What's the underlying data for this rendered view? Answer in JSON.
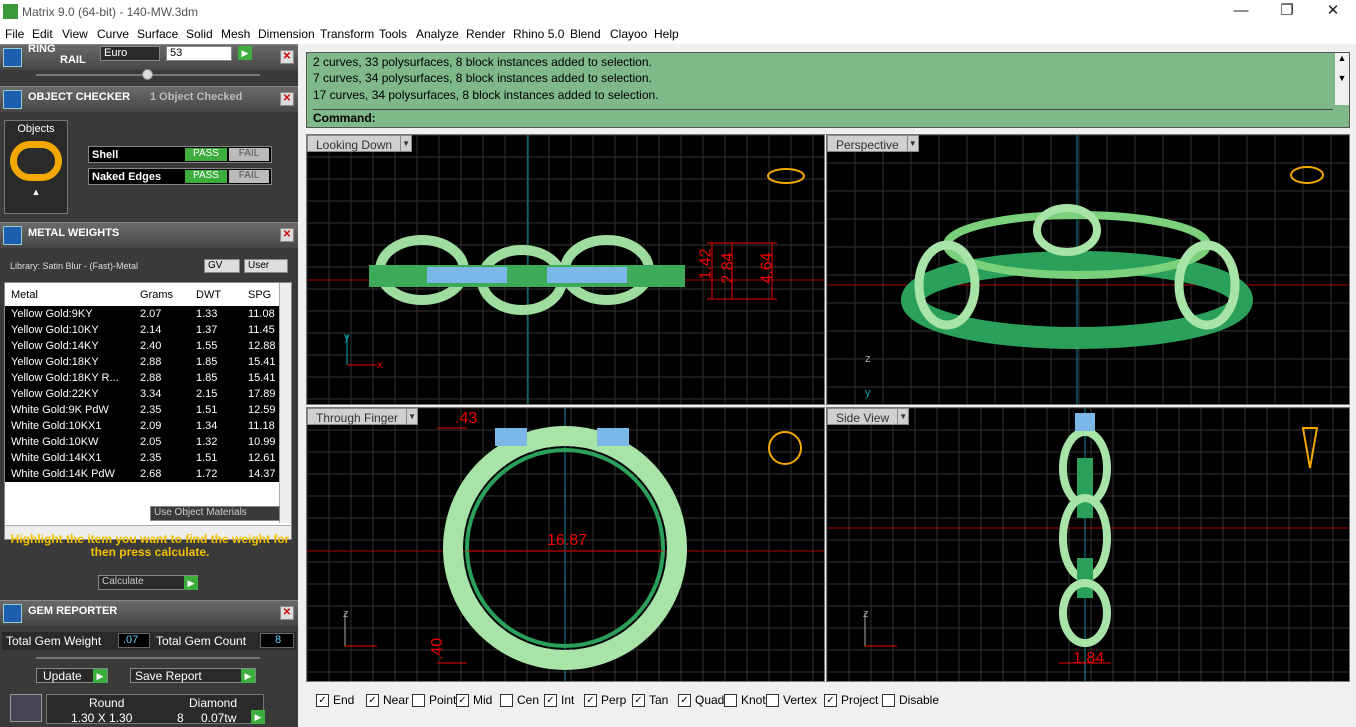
{
  "window": {
    "title": "Matrix 9.0 (64-bit) - 140-MW.3dm",
    "min": "—",
    "max": "❐",
    "close": "✕"
  },
  "menu": [
    "File",
    "Edit",
    "View",
    "Curve",
    "Surface",
    "Solid",
    "Mesh",
    "Dimension",
    "Transform",
    "Tools",
    "Analyze",
    "Render",
    "Rhino 5.0",
    "Blend",
    "Clayoo",
    "Help"
  ],
  "ringrail": {
    "label1": "RING",
    "label2": "RAIL",
    "standard": "Euro",
    "size": "53"
  },
  "checker": {
    "title": "OBJECT CHECKER",
    "status": "1 Object Checked",
    "objects_label": "Objects",
    "shell": "Shell",
    "naked": "Naked Edges",
    "pass": "PASS",
    "fail": "FAIL"
  },
  "weights": {
    "title": "METAL WEIGHTS",
    "library": "Library: Satin Blur - (Fast)-Metal",
    "gv": "GV",
    "user": "User",
    "cols": [
      "Metal",
      "Grams",
      "DWT",
      "SPG"
    ],
    "rows": [
      [
        "Yellow Gold:9KY",
        "2.07",
        "1.33",
        "11.08"
      ],
      [
        "Yellow Gold:10KY",
        "2.14",
        "1.37",
        "11.45"
      ],
      [
        "Yellow Gold:14KY",
        "2.40",
        "1.55",
        "12.88"
      ],
      [
        "Yellow Gold:18KY",
        "2.88",
        "1.85",
        "15.41"
      ],
      [
        "Yellow Gold:18KY R...",
        "2.88",
        "1.85",
        "15.41"
      ],
      [
        "Yellow Gold:22KY",
        "3.34",
        "2.15",
        "17.89"
      ],
      [
        "White Gold:9K PdW",
        "2.35",
        "1.51",
        "12.59"
      ],
      [
        "White Gold:10KX1",
        "2.09",
        "1.34",
        "11.18"
      ],
      [
        "White Gold:10KW",
        "2.05",
        "1.32",
        "10.99"
      ],
      [
        "White Gold:14KX1",
        "2.35",
        "1.51",
        "12.61"
      ],
      [
        "White Gold:14K PdW",
        "2.68",
        "1.72",
        "14.37"
      ]
    ],
    "use_obj": "Use Object Materials",
    "hint": "Highlight the item you want to find the weight for then press calculate.",
    "calc": "Calculate"
  },
  "gems": {
    "title": "GEM REPORTER",
    "tgw_label": "Total Gem Weight",
    "tgw": ".07",
    "tgc_label": "Total Gem Count",
    "tgc": "8",
    "update": "Update",
    "save": "Save Report",
    "shape": "Round",
    "size": "1.30 X 1.30",
    "type": "Diamond",
    "count": "8",
    "ctw": "0.07tw"
  },
  "command": {
    "lines": [
      "2 curves, 33 polysurfaces, 8 block instances added to selection.",
      "7 curves, 34 polysurfaces, 8 block instances added to selection.",
      "17 curves, 34 polysurfaces, 8 block instances added to selection."
    ],
    "prompt": "Command:"
  },
  "viewports": {
    "top": "Looking Down",
    "persp": "Perspective",
    "front": "Through Finger",
    "side": "Side View"
  },
  "dims": {
    "d1": "1.42",
    "d2": "2.84",
    "d3": "4.64",
    "d4": ".43",
    "d5": "16.87",
    "d6": ".40",
    "d7": "1.84"
  },
  "axes": {
    "x": "x",
    "y": "y",
    "z": "z"
  },
  "snaps": [
    {
      "label": "End",
      "on": true
    },
    {
      "label": "Near",
      "on": true
    },
    {
      "label": "Point",
      "on": false
    },
    {
      "label": "Mid",
      "on": true
    },
    {
      "label": "Cen",
      "on": false
    },
    {
      "label": "Int",
      "on": true
    },
    {
      "label": "Perp",
      "on": true
    },
    {
      "label": "Tan",
      "on": true
    },
    {
      "label": "Quad",
      "on": true
    },
    {
      "label": "Knot",
      "on": false
    },
    {
      "label": "Vertex",
      "on": false
    },
    {
      "label": "Project",
      "on": true
    },
    {
      "label": "Disable",
      "on": false
    }
  ]
}
